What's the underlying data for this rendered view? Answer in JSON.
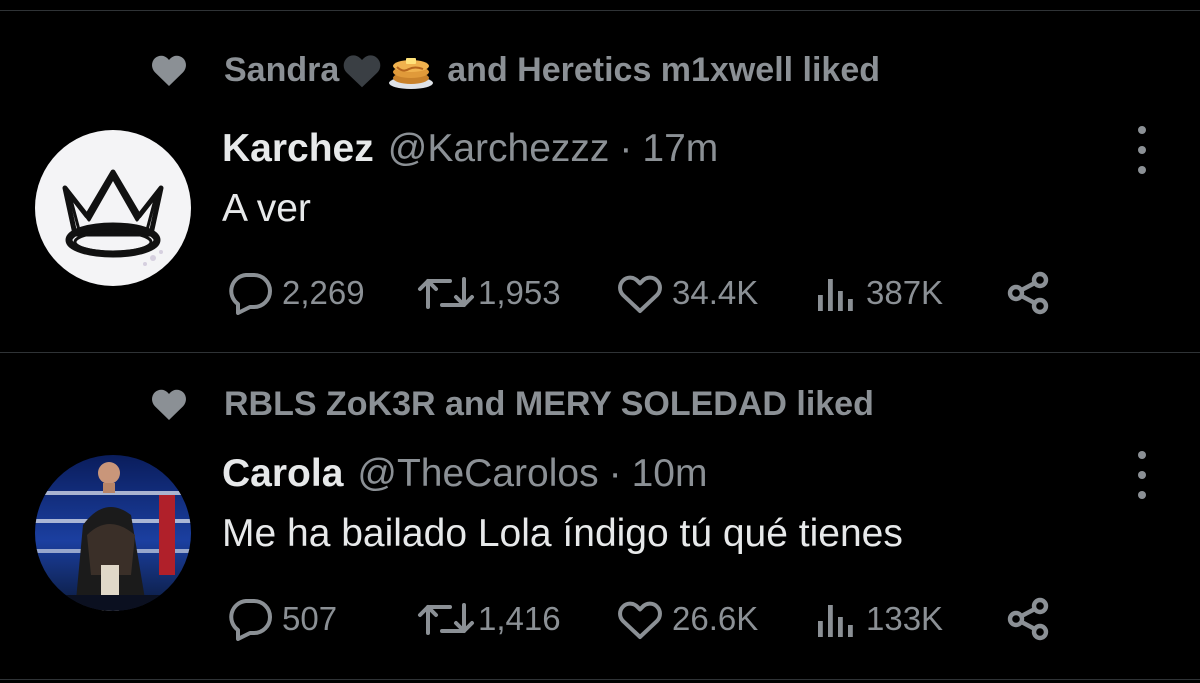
{
  "tweets": [
    {
      "social": {
        "pre": "Sandra",
        "emojis": [
          "black-heart-icon",
          "pancakes-icon"
        ],
        "post": "and Heretics m1xwell liked"
      },
      "author": {
        "name": "Karchez",
        "handle": "@Karchezzz",
        "separator": "·",
        "time": "17m"
      },
      "avatar": "crown-logo-avatar",
      "text": "A ver",
      "stats": {
        "replies": "2,269",
        "retweets": "1,953",
        "likes": "34.4K",
        "views": "387K"
      }
    },
    {
      "social": {
        "pre": "RBLS ZoK3R and MERY SOLEDAD liked",
        "emojis": [],
        "post": ""
      },
      "author": {
        "name": "Carola",
        "handle": "@TheCarolos",
        "separator": "·",
        "time": "10m"
      },
      "avatar": "boxer-photo-avatar",
      "text": "Me ha bailado Lola índigo tú qué tienes",
      "stats": {
        "replies": "507",
        "retweets": "1,416",
        "likes": "26.6K",
        "views": "133K"
      }
    }
  ],
  "colors": {
    "background": "#000000",
    "text": "#e7e9ea",
    "muted": "#8b9095",
    "divider": "#2f3336"
  }
}
